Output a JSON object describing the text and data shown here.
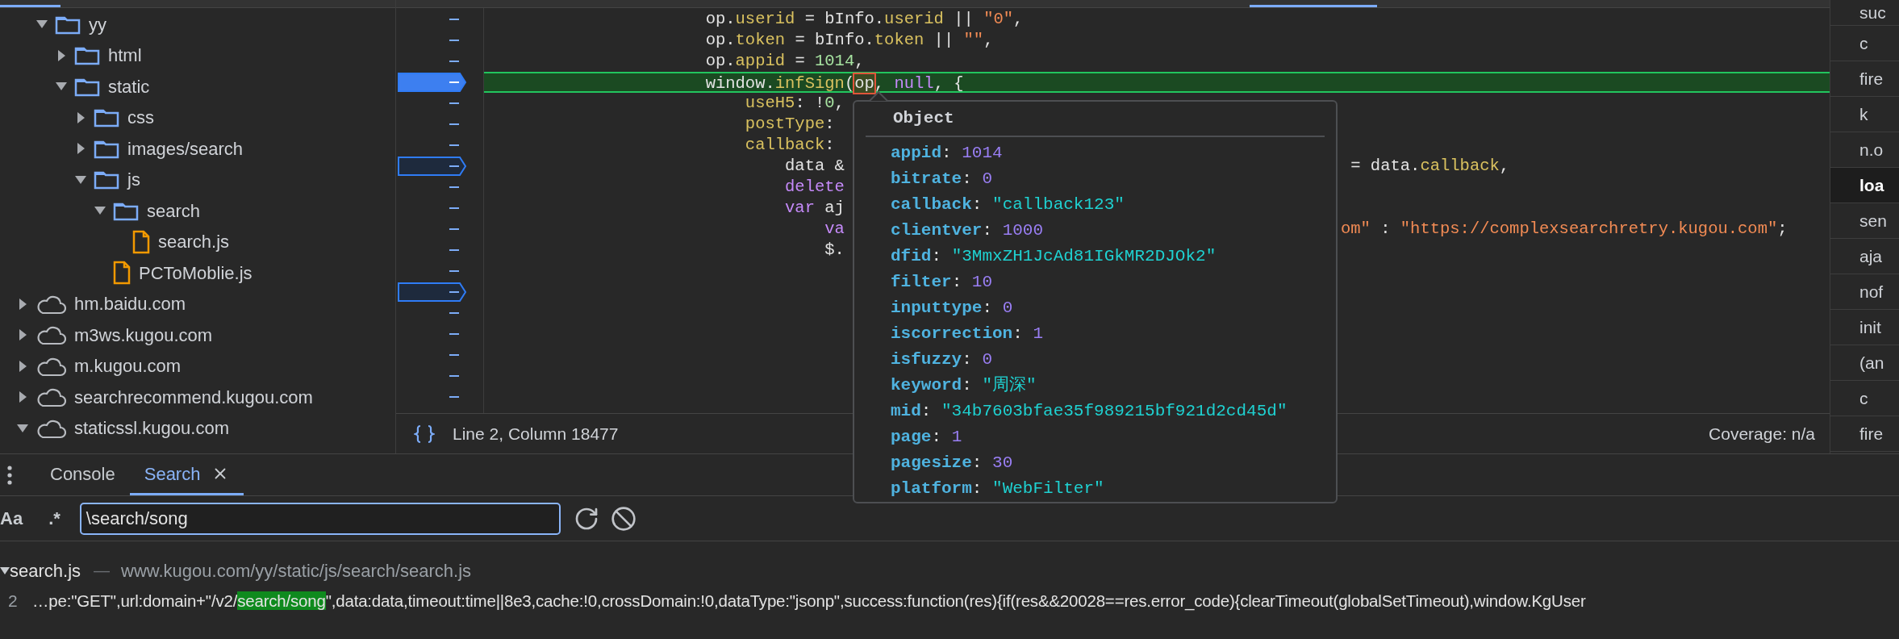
{
  "navigator": {
    "tree": [
      {
        "label": "yy",
        "kind": "folder",
        "expanded": true,
        "children": [
          {
            "label": "html",
            "kind": "folder",
            "expanded": false
          },
          {
            "label": "static",
            "kind": "folder",
            "expanded": true,
            "children": [
              {
                "label": "css",
                "kind": "folder",
                "expanded": false
              },
              {
                "label": "images/search",
                "kind": "folder",
                "expanded": false
              },
              {
                "label": "js",
                "kind": "folder",
                "expanded": true,
                "children": [
                  {
                    "label": "search",
                    "kind": "folder",
                    "expanded": true,
                    "children": [
                      {
                        "label": "search.js",
                        "kind": "file"
                      }
                    ]
                  },
                  {
                    "label": "PCToMoblie.js",
                    "kind": "file"
                  }
                ]
              }
            ]
          }
        ]
      },
      {
        "label": "hm.baidu.com",
        "kind": "domain",
        "expanded": false
      },
      {
        "label": "m3ws.kugou.com",
        "kind": "domain",
        "expanded": false
      },
      {
        "label": "m.kugou.com",
        "kind": "domain",
        "expanded": false
      },
      {
        "label": "searchrecommend.kugou.com",
        "kind": "domain",
        "expanded": false
      },
      {
        "label": "staticssl.kugou.com",
        "kind": "domain",
        "expanded": true
      }
    ]
  },
  "editor": {
    "lines": [
      {
        "paused": false,
        "breakpoint": false,
        "tokens": [
          {
            "text": "                      op.",
            "kind": "plain"
          },
          {
            "text": "userid",
            "kind": "prop"
          },
          {
            "text": " = bInfo.",
            "kind": "plain"
          },
          {
            "text": "userid",
            "kind": "prop"
          },
          {
            "text": " || ",
            "kind": "plain"
          },
          {
            "text": "\"0\"",
            "kind": "str"
          },
          {
            "text": ",",
            "kind": "plain"
          }
        ]
      },
      {
        "paused": false,
        "breakpoint": false,
        "tokens": [
          {
            "text": "                      op.",
            "kind": "plain"
          },
          {
            "text": "token",
            "kind": "prop"
          },
          {
            "text": " = bInfo.",
            "kind": "plain"
          },
          {
            "text": "token",
            "kind": "prop"
          },
          {
            "text": " || ",
            "kind": "plain"
          },
          {
            "text": "\"\"",
            "kind": "str"
          },
          {
            "text": ",",
            "kind": "plain"
          }
        ]
      },
      {
        "paused": false,
        "breakpoint": false,
        "tokens": [
          {
            "text": "                      op.",
            "kind": "plain"
          },
          {
            "text": "appid",
            "kind": "prop"
          },
          {
            "text": " = ",
            "kind": "plain"
          },
          {
            "text": "1014",
            "kind": "num"
          },
          {
            "text": ",",
            "kind": "plain"
          }
        ]
      },
      {
        "paused": true,
        "breakpoint": true,
        "tokens": [
          {
            "text": "                      window.",
            "kind": "plain"
          },
          {
            "text": "infSign",
            "kind": "prop"
          },
          {
            "text": "(",
            "kind": "plain"
          },
          {
            "text": "op",
            "kind": "focus"
          },
          {
            "text": ", ",
            "kind": "plain"
          },
          {
            "text": "null",
            "kind": "kw"
          },
          {
            "text": ", {",
            "kind": "plain"
          }
        ]
      },
      {
        "paused": false,
        "breakpoint": false,
        "tokens": [
          {
            "text": "                          useH5",
            "kind": "prop"
          },
          {
            "text": ": !",
            "kind": "plain"
          },
          {
            "text": "0",
            "kind": "num"
          },
          {
            "text": ",",
            "kind": "plain"
          }
        ]
      },
      {
        "paused": false,
        "breakpoint": false,
        "tokens": [
          {
            "text": "                          postType",
            "kind": "prop"
          },
          {
            "text": ":",
            "kind": "plain"
          }
        ]
      },
      {
        "paused": false,
        "breakpoint": false,
        "tokens": [
          {
            "text": "                          callback",
            "kind": "prop"
          },
          {
            "text": ":",
            "kind": "plain"
          }
        ]
      },
      {
        "paused": false,
        "breakpoint": true,
        "tokens": [
          {
            "text": "                              data &",
            "kind": "plain"
          }
        ],
        "right": [
          {
            "text": " = data.",
            "kind": "plain"
          },
          {
            "text": "callback",
            "kind": "prop"
          },
          {
            "text": ",",
            "kind": "plain"
          }
        ]
      },
      {
        "paused": false,
        "breakpoint": false,
        "tokens": [
          {
            "text": "                              delete",
            "kind": "kw"
          }
        ]
      },
      {
        "paused": false,
        "breakpoint": false,
        "tokens": [
          {
            "text": "                              var",
            "kind": "kw"
          },
          {
            "text": " aj",
            "kind": "plain"
          }
        ]
      },
      {
        "paused": false,
        "breakpoint": false,
        "tokens": [
          {
            "text": "                                  va",
            "kind": "kw"
          }
        ],
        "right": [
          {
            "text": "om\"",
            "kind": "str"
          },
          {
            "text": " : ",
            "kind": "plain"
          },
          {
            "text": "\"https://complexsearchretry.kugou.com\"",
            "kind": "str"
          },
          {
            "text": ";",
            "kind": "plain"
          }
        ]
      },
      {
        "paused": false,
        "breakpoint": false,
        "tokens": [
          {
            "text": "                                  $.",
            "kind": "plain"
          }
        ]
      },
      {
        "paused": false,
        "breakpoint": false
      },
      {
        "paused": false,
        "breakpoint": true
      },
      {
        "paused": false,
        "breakpoint": false
      },
      {
        "paused": false,
        "breakpoint": false
      },
      {
        "paused": false,
        "breakpoint": false
      },
      {
        "paused": false,
        "breakpoint": false
      },
      {
        "paused": false,
        "breakpoint": false
      }
    ],
    "status": {
      "position": "Line 2, Column 18477",
      "coverage": "Coverage: n/a"
    }
  },
  "call_stack": [
    {
      "label": "suc",
      "selected": false
    },
    {
      "label": "c",
      "selected": false
    },
    {
      "label": "fire",
      "selected": false
    },
    {
      "label": "k",
      "selected": false
    },
    {
      "label": "n.o",
      "selected": false
    },
    {
      "label": "loa",
      "selected": true
    },
    {
      "label": "sen",
      "selected": false
    },
    {
      "label": "aja",
      "selected": false
    },
    {
      "label": "nof",
      "selected": false
    },
    {
      "label": "init",
      "selected": false
    },
    {
      "label": "(an",
      "selected": false
    },
    {
      "label": "c",
      "selected": false
    },
    {
      "label": "fire",
      "selected": false
    }
  ],
  "popover": {
    "title": "Object",
    "properties": [
      {
        "key": "appid",
        "colon": ":",
        "value": "1014",
        "kind": "num"
      },
      {
        "key": "bitrate",
        "colon": ":",
        "value": "0",
        "kind": "num"
      },
      {
        "key": "callback",
        "colon": ":",
        "value": "\"callback123\"",
        "kind": "str"
      },
      {
        "key": "clientver",
        "colon": ":",
        "value": "1000",
        "kind": "num"
      },
      {
        "key": "dfid",
        "colon": ":",
        "value": "\"3MmxZH1JcAd81IGkMR2DJOk2\"",
        "kind": "str"
      },
      {
        "key": "filter",
        "colon": ":",
        "value": "10",
        "kind": "num"
      },
      {
        "key": "inputtype",
        "colon": ":",
        "value": "0",
        "kind": "num"
      },
      {
        "key": "iscorrection",
        "colon": ":",
        "value": "1",
        "kind": "num"
      },
      {
        "key": "isfuzzy",
        "colon": ":",
        "value": "0",
        "kind": "num"
      },
      {
        "key": "keyword",
        "colon": ":",
        "value": "\"周深\"",
        "kind": "str"
      },
      {
        "key": "mid",
        "colon": ":",
        "value": "\"34b7603bfae35f989215bf921d2cd45d\"",
        "kind": "str"
      },
      {
        "key": "page",
        "colon": ":",
        "value": "1",
        "kind": "num"
      },
      {
        "key": "pagesize",
        "colon": ":",
        "value": "30",
        "kind": "num"
      },
      {
        "key": "platform",
        "colon": ":",
        "value": "\"WebFilter\"",
        "kind": "str"
      }
    ]
  },
  "drawer": {
    "tabs": [
      {
        "label": "Console",
        "selected": false,
        "closable": false
      },
      {
        "label": "Search",
        "selected": true,
        "closable": true
      }
    ]
  },
  "search": {
    "case_toggle": "Aa",
    "regex_toggle": ".*",
    "query": "\\search/song"
  },
  "results": [
    {
      "file": "search.js",
      "separator": "—",
      "url": "www.kugou.com/yy/static/js/search/search.js",
      "expanded": true,
      "matches": [
        {
          "line": "2",
          "before": "…pe:\"GET\",url:domain+\"/v2/",
          "match": "search/song",
          "after": "\",data:data,timeout:time||8e3,cache:!0,crossDomain:!0,dataType:\"jsonp\",success:function(res){if(res&&20028==res.error_code){clearTimeout(globalSetTimeout),window.KgUser"
        }
      ]
    }
  ]
}
